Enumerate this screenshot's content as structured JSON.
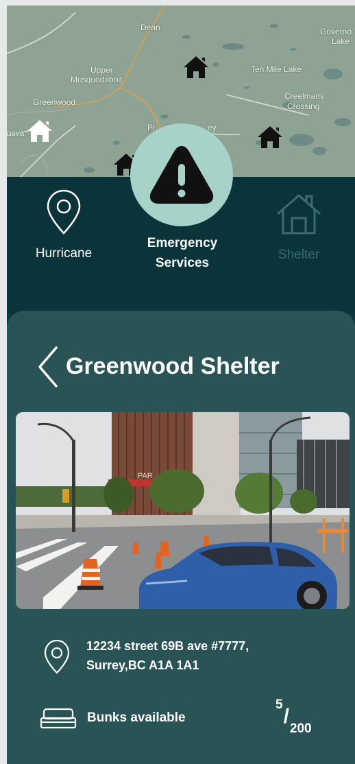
{
  "map": {
    "labels": [
      "Dean",
      "Governo",
      "Lake",
      "Upper",
      "Musquodoboit",
      "Ten Mile Lake",
      "Greenwood",
      "Creelmans",
      "Crossing",
      "nsva",
      "Pi",
      "ey"
    ],
    "shelter_pins": 5
  },
  "nav": {
    "left_label": "Hurricane",
    "center_label_line1": "Emergency",
    "center_label_line2": "Services",
    "right_label": "Shelter"
  },
  "shelter": {
    "title": "Greenwood Shelter",
    "address_line1": "12234 street 69B ave #7777,",
    "address_line2": "Surrey,BC A1A 1A1",
    "bunks_label": "Bunks available",
    "bunks_available": "5",
    "bunks_total": "200",
    "photo_sign": "PAR"
  },
  "colors": {
    "nav_bg": "#0b343a",
    "card_bg": "#2a5356",
    "accent_circle": "#a6d2ca",
    "map_bg": "#8fa496",
    "inactive": "#3b6c71"
  }
}
